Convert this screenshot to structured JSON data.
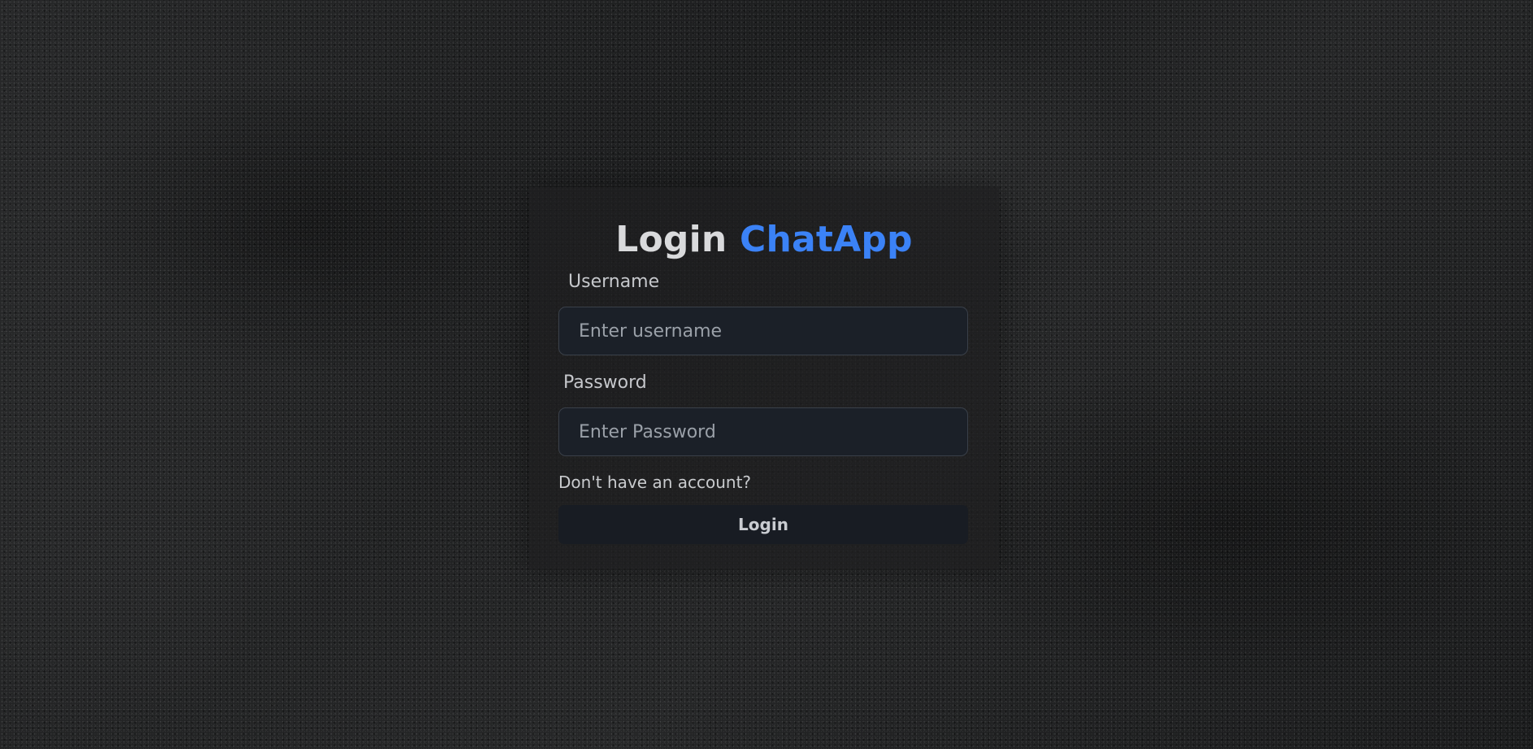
{
  "login_form": {
    "title_prefix": "Login",
    "title_brand": "ChatApp",
    "username": {
      "label": "Username",
      "placeholder": "Enter username",
      "value": ""
    },
    "password": {
      "label": "Password",
      "placeholder": "Enter Password",
      "value": ""
    },
    "signup_link": "Don't have an account?",
    "submit_label": "Login"
  },
  "colors": {
    "brand_accent": "#3b82f6",
    "card_background": "#1e1f20",
    "input_background": "#1b2028",
    "button_background": "#181c23"
  }
}
